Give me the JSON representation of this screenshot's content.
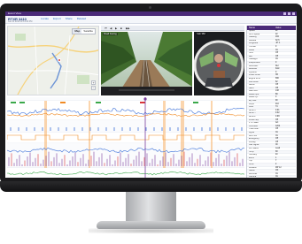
{
  "app": {
    "title": "Event View",
    "vehicle_name": "RTXR 3410",
    "vehicle_sub": "Jan 24 2019  12:14:03 PM",
    "links": [
      "Locate",
      "Export",
      "Share",
      "Related"
    ]
  },
  "map": {
    "toggle": [
      "Map",
      "Satellite"
    ],
    "active": "Map",
    "zoom_in": "+",
    "zoom_out": "−"
  },
  "player": {
    "controls": [
      "⏮",
      "◀",
      "▶",
      "■",
      "▶▶"
    ],
    "camera_a_label": "Road Facing",
    "camera_b_label": "Cab 360"
  },
  "table": {
    "headers": [
      "Name",
      "Value"
    ],
    "rows": [
      {
        "k": "Speed",
        "v": "22"
      },
      {
        "k": "GPS Speed",
        "v": "22"
      },
      {
        "k": "Heading",
        "v": "184"
      },
      {
        "k": "Latitude",
        "v": "32.6"
      },
      {
        "k": "Longitude",
        "v": "-97.1"
      },
      {
        "k": "Throttle",
        "v": "0"
      },
      {
        "k": "Brake",
        "v": "On"
      },
      {
        "k": "Horn",
        "v": "Off"
      },
      {
        "k": "Bell",
        "v": "Off"
      },
      {
        "k": "Headlight",
        "v": "On"
      },
      {
        "k": "Independent",
        "v": "0"
      },
      {
        "k": "Automatic",
        "v": "Rel"
      },
      {
        "k": "Reverser",
        "v": "Fwd"
      },
      {
        "k": "Dynamic",
        "v": "0"
      },
      {
        "k": "Power Level",
        "v": "N5"
      },
      {
        "k": "Engine RPM",
        "v": "680"
      },
      {
        "k": "Fuel Level",
        "v": "62"
      },
      {
        "k": "Alerter",
        "v": "Off"
      },
      {
        "k": "Sand",
        "v": "Off"
      },
      {
        "k": "Main Res.",
        "v": "138"
      },
      {
        "k": "Brake Pipe",
        "v": "89"
      },
      {
        "k": "Brake Cyl.",
        "v": "0"
      },
      {
        "k": "Eq. Res.",
        "v": "90"
      },
      {
        "k": "Amps",
        "v": "410"
      },
      {
        "k": "Volts",
        "v": "74"
      },
      {
        "k": "Accel X",
        "v": "0.01"
      },
      {
        "k": "Accel Y",
        "v": "0.02"
      },
      {
        "k": "Accel Z",
        "v": "0.98"
      },
      {
        "k": "Wheel Slip",
        "v": "Off"
      },
      {
        "k": "PTC State",
        "v": "Act"
      },
      {
        "k": "Odometer",
        "v": "1204"
      },
      {
        "k": "Track Warr.",
        "v": "Off"
      },
      {
        "k": "Lights",
        "v": "On"
      },
      {
        "k": "Ditch Lts",
        "v": "On"
      },
      {
        "k": "Emergency",
        "v": "Off"
      },
      {
        "k": "Penalty",
        "v": "Off"
      },
      {
        "k": "Cab Signal",
        "v": "Clr"
      },
      {
        "k": "MU Status",
        "v": "Lead"
      },
      {
        "k": "Temp",
        "v": "68"
      },
      {
        "k": "Humidity",
        "v": "40"
      },
      {
        "k": "Event",
        "v": "1"
      },
      {
        "k": "Trip",
        "v": "7"
      },
      {
        "k": "Crew",
        "v": "2"
      },
      {
        "k": "Location",
        "v": "MP 12"
      },
      {
        "k": "Status",
        "v": "OK"
      },
      {
        "k": "Recorder",
        "v": "On"
      },
      {
        "k": "Camera",
        "v": "On"
      }
    ]
  },
  "colors": {
    "brand": "#4a2a78",
    "link": "#2d6fc2",
    "trace_blue": "#3a6fd8",
    "trace_orange": "#f08a24",
    "trace_red": "#d8343a",
    "trace_green": "#3aa84a"
  }
}
